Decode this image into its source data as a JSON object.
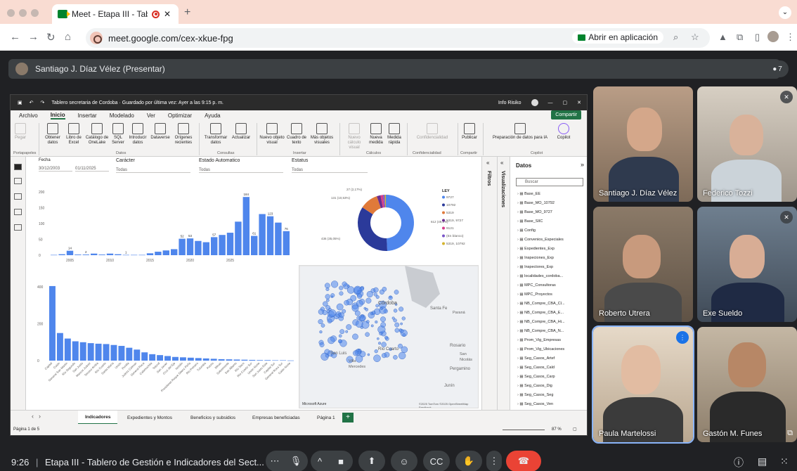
{
  "browser": {
    "tab_title": "Meet - Etapa III - Tablero",
    "url": "meet.google.com/cex-xkue-fpg",
    "open_app_label": "Abrir en aplicación"
  },
  "meet": {
    "presenter_label": "Santiago J. Díaz Vélez (Presentar)",
    "people_count": "7",
    "meeting_time": "9:26",
    "meeting_title": "Etapa III - Tablero de Gestión e Indicadores del Sect...",
    "participants": [
      {
        "name": "Santiago J. Díaz Vélez",
        "muted": false
      },
      {
        "name": "Federico Tozzi",
        "muted": true
      },
      {
        "name": "Roberto Utrera",
        "muted": false
      },
      {
        "name": "Exe Sueldo",
        "muted": true
      },
      {
        "name": "Paula Martelossi",
        "muted": false,
        "speaking": true
      },
      {
        "name": "Gastón M. Funes",
        "muted": false
      }
    ]
  },
  "powerbi": {
    "title_bar": "Tablero secretaria de Cordoba · Guardado por última vez: Ayer a las 9:15 p. m.",
    "user": "Info Risiko",
    "menus": [
      "Archivo",
      "Inicio",
      "Insertar",
      "Modelado",
      "Ver",
      "Optimizar",
      "Ayuda"
    ],
    "share_label": "Compartir",
    "ribbon": {
      "pegar": "Pegar",
      "portapapeles": "Portapapeles",
      "obtener": "Obtener datos",
      "libro": "Libro de Excel",
      "catalogo": "Catálogo de OneLake",
      "sql": "SQL Server",
      "introducir": "Introducir datos",
      "dataverse": "Dataverse",
      "origenes": "Orígenes recientes",
      "datos_grp": "Datos",
      "transformar": "Transformar datos",
      "actualizar": "Actualizar",
      "consultas_grp": "Consultas",
      "nuevo_objeto": "Nuevo objeto visual",
      "cuadro_texto": "Cuadro de texto",
      "mas_objetos": "Más objetos visuales",
      "insertar_grp": "Insertar",
      "nuevo_calculo": "Nuevo cálculo visual",
      "nueva_medida": "Nueva medida",
      "medida_rapida": "Medida rápida",
      "calculos_grp": "Cálculos",
      "confidencialidad": "Confidencialidad",
      "confid_grp": "Confidencialidad",
      "publicar": "Publicar",
      "compartir_grp": "Compartir",
      "preparacion": "Preparación de datos para IA",
      "copilot": "Copilot",
      "copilot_grp": "Copilot"
    },
    "slicers": {
      "fecha_label": "Fecha",
      "fecha_from": "30/12/2003",
      "fecha_to": "01/11/2025",
      "caracter_label": "Carácter",
      "caracter_value": "Todas",
      "estado_label": "Estado Automatico",
      "estado_value": "Todas",
      "estatus_label": "Estatus",
      "estatus_value": "Todas"
    },
    "filters_label": "Filtros",
    "viz_label": "Visualizaciones",
    "datos_label": "Datos",
    "search_placeholder": "Buscar",
    "tables": [
      "Base_EE",
      "Base_MO_10792",
      "Base_MO_9727",
      "Base_SIIC",
      "Config",
      "Convenios_Especiales",
      "Expedientes_Exp",
      "Inspeciones_Exp",
      "Inspectores_Exp",
      "localidades_cordoba...",
      "MPC_Consultoras",
      "MPC_Proyectos",
      "NB_Compre_CBA_Cl...",
      "NB_Compre_CBA_E...",
      "NB_Compre_CBA_Hi...",
      "NB_Compre_CBA_N...",
      "Prom_Vig_Empresas",
      "Prom_Vig_Ubicaciones",
      "Seg_Casos_Artef",
      "Seg_Casos_Cald",
      "Seg_Casos_Carp",
      "Seg_Casos_Dig",
      "Seg_Casos_Seg",
      "Seg_Casos_Ven"
    ],
    "page_tabs": [
      "Indicadores",
      "Expedientes y Montos",
      "Beneficios y subsidios",
      "Empresas beneficiadas",
      "Página 1"
    ],
    "page_indicator": "Página 1 de 5",
    "zoom": "87 %",
    "map_attribution": "Microsoft Azure",
    "map_copyright": "©2025 TomTom ©2025 OpenStreetMap Feedback",
    "map_places": [
      "Córdoba",
      "Santa Fe",
      "Paraná",
      "Río Cuarto",
      "San Luis",
      "Villa Mercedes",
      "Rosario",
      "San Nicolás",
      "Pergamino",
      "Junín"
    ]
  },
  "chart_data": [
    {
      "type": "bar",
      "x_tick_labels": [
        "2005",
        "2010",
        "2015",
        "2020",
        "2025"
      ],
      "y_tick_labels": [
        "0",
        "50",
        "100",
        "150",
        "200"
      ],
      "ylim": [
        0,
        200
      ],
      "values": [
        1,
        3,
        14,
        2,
        2,
        5,
        2,
        5,
        3,
        1,
        1,
        1,
        6,
        11,
        15,
        19,
        52,
        53,
        45,
        41,
        57,
        64,
        71,
        106,
        184,
        61,
        130,
        123,
        103,
        76
      ],
      "data_labels": [
        {
          "index": 2,
          "text": "14"
        },
        {
          "index": 4,
          "text": "2"
        },
        {
          "index": 9,
          "text": "1"
        },
        {
          "index": 16,
          "text": "52"
        },
        {
          "index": 17,
          "text": "53"
        },
        {
          "index": 20,
          "text": "57"
        },
        {
          "index": 24,
          "text": "184"
        },
        {
          "index": 25,
          "text": "61"
        },
        {
          "index": 27,
          "text": "123"
        },
        {
          "index": 29,
          "text": "76"
        }
      ],
      "color": "#4f86ec"
    },
    {
      "type": "pie",
      "donut": true,
      "legend_title": "LEY",
      "slices": [
        {
          "label": "9727",
          "value": 612,
          "pct_label": "612 (49,2%)",
          "color": "#4f86ec"
        },
        {
          "label": "10792",
          "value": 436,
          "pct_label": "436 (35,05%)",
          "color": "#2b3a9a"
        },
        {
          "label": "5319",
          "value": 131,
          "pct_label": "131 (10,53%)",
          "color": "#e07a3a"
        },
        {
          "label": "5319, 9727",
          "value": 27,
          "pct_label": "27 (2,17%)",
          "color": "#6b2c8f"
        },
        {
          "label": "9121",
          "value": 18,
          "pct_label": "",
          "color": "#d63e8a"
        },
        {
          "label": "(En blanco)",
          "value": 12,
          "pct_label": "",
          "color": "#7a56c8"
        },
        {
          "label": "5319, 10792",
          "value": 8,
          "pct_label": "",
          "color": "#d4b42e"
        }
      ]
    },
    {
      "type": "bar",
      "y_tick_labels": [
        "0",
        "200",
        "400"
      ],
      "ylim": [
        0,
        420
      ],
      "categories": [
        "Capital",
        "Colón",
        "General San Martín",
        "Río Segundo",
        "San Justo",
        "Marcos Juárez",
        "Tercero Arriba",
        "Río Cuarto",
        "Santa María",
        "Unión",
        "Punilla",
        "Juárez Celman",
        "General Roca",
        "Calamuchita",
        "Totoral",
        "San Javier",
        "Cruz del Eje",
        "Ischilín",
        "Presidente Roque Sáenz Peña",
        "Río Primero",
        "Tulumba",
        "Pocho",
        "Minas",
        "Sobremonte",
        "San Alberto",
        "Río Seco",
        "Río Cuarto Sur",
        "Unión Norte",
        "San Justo Este",
        "Capital Sur",
        "General Roca Sur",
        "Colón Norte"
      ],
      "values": [
        405,
        150,
        120,
        105,
        100,
        95,
        92,
        90,
        85,
        80,
        70,
        60,
        45,
        35,
        30,
        25,
        20,
        18,
        16,
        14,
        12,
        10,
        8,
        7,
        6,
        5,
        4,
        3,
        3,
        2,
        2,
        1
      ],
      "color": "#4f86ec"
    }
  ]
}
